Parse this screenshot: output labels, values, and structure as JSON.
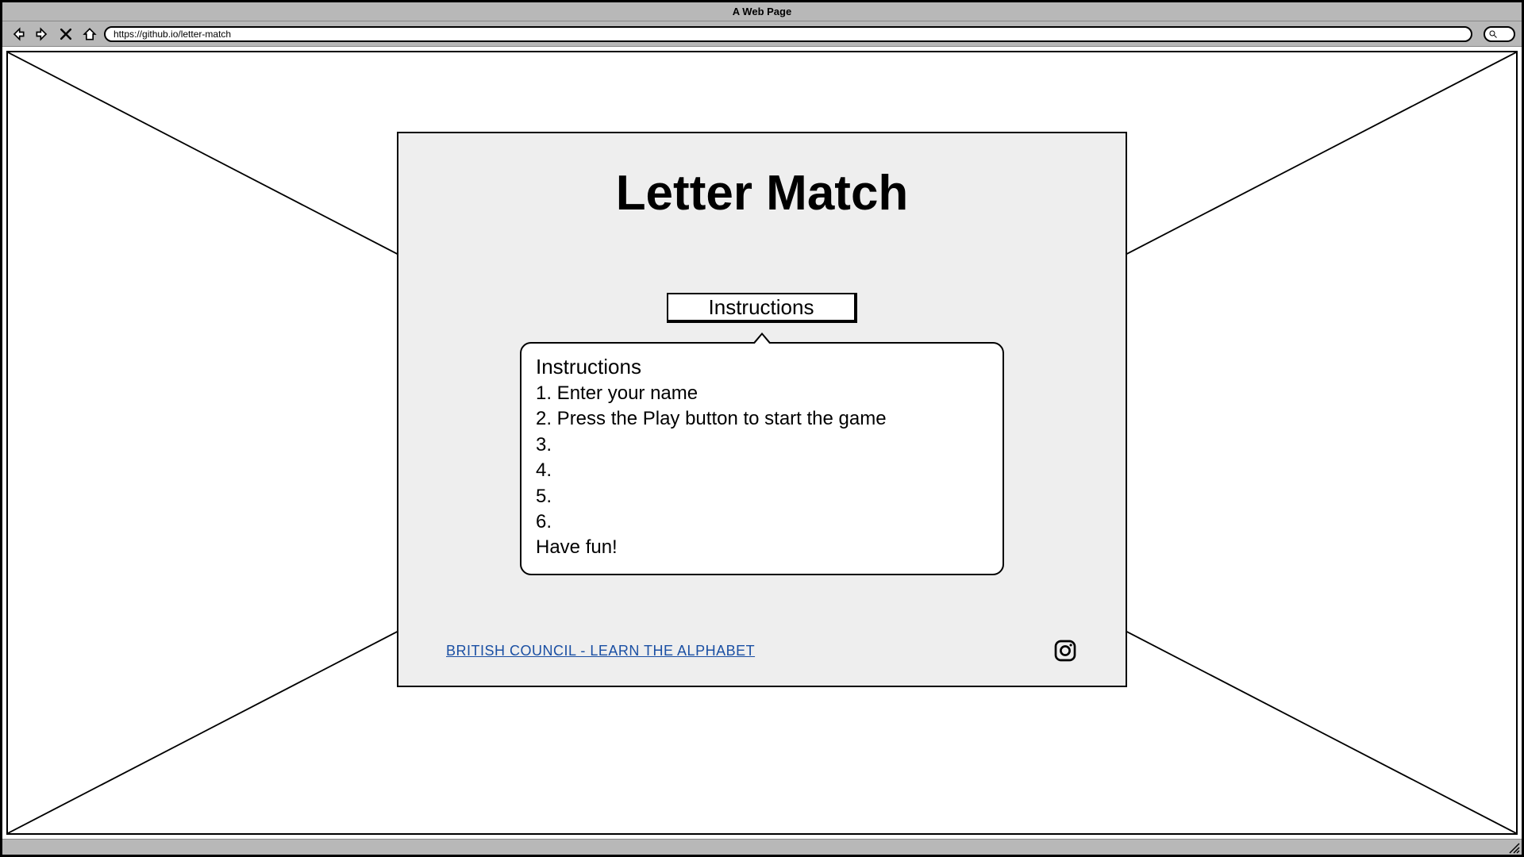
{
  "browser": {
    "title": "A Web Page",
    "url": "https://github.io/letter-match"
  },
  "card": {
    "title": "Letter Match",
    "instructions_button": "Instructions",
    "popover": {
      "heading": "Instructions",
      "lines": [
        "1. Enter your name",
        "2. Press the Play button to start the game",
        "3.",
        "4.",
        "5.",
        "6.",
        "Have fun!"
      ]
    },
    "footer_link": "BRITISH COUNCIL - LEARN THE ALPHABET"
  }
}
